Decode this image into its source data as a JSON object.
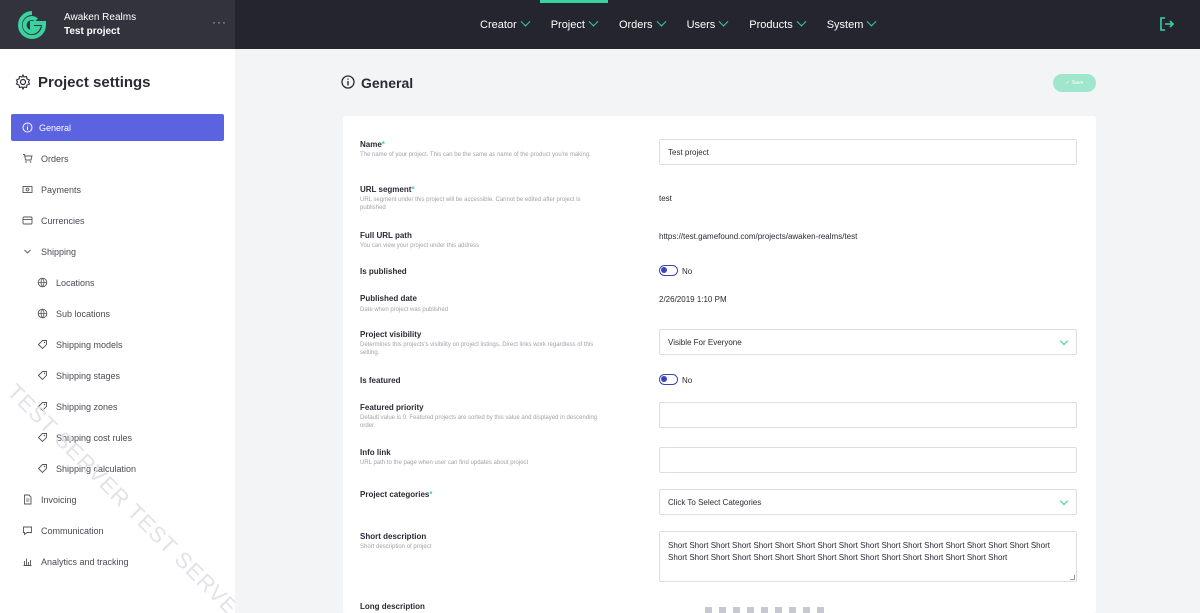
{
  "app": {
    "name": "Awaken Realms",
    "project": "Test project",
    "more": "···"
  },
  "colors": {
    "accent": "#3ad29f",
    "active": "#5b63e0",
    "topbar": "#25252f"
  },
  "nav": {
    "items": [
      {
        "label": "Creator"
      },
      {
        "label": "Project"
      },
      {
        "label": "Orders"
      },
      {
        "label": "Users"
      },
      {
        "label": "Products"
      },
      {
        "label": "System"
      }
    ],
    "active": "Project"
  },
  "sidebar": {
    "title": "Project settings",
    "items": [
      {
        "label": "General",
        "icon": "info-icon"
      },
      {
        "label": "Orders",
        "icon": "cart-icon"
      },
      {
        "label": "Payments",
        "icon": "cash-icon"
      },
      {
        "label": "Currencies",
        "icon": "currency-icon"
      },
      {
        "label": "Shipping",
        "icon": "chevron-down-icon"
      },
      {
        "label": "Locations",
        "icon": "globe-icon"
      },
      {
        "label": "Sub locations",
        "icon": "globe-icon"
      },
      {
        "label": "Shipping models",
        "icon": "tag-icon"
      },
      {
        "label": "Shipping stages",
        "icon": "tag-icon"
      },
      {
        "label": "Shipping zones",
        "icon": "tag-icon"
      },
      {
        "label": "Shipping cost rules",
        "icon": "tag-icon"
      },
      {
        "label": "Shipping calculation",
        "icon": "tag-icon"
      },
      {
        "label": "Invoicing",
        "icon": "document-icon"
      },
      {
        "label": "Communication",
        "icon": "chat-icon"
      },
      {
        "label": "Analytics and tracking",
        "icon": "chart-icon"
      }
    ],
    "watermark": "TEST SERVER TEST SERVER"
  },
  "main": {
    "title": "General",
    "save_label": "Save"
  },
  "form": {
    "name": {
      "label": "Name",
      "help": "The name of your project. This can be the same as name of the product you're making.",
      "value": "Test project"
    },
    "url_segment": {
      "label": "URL segment",
      "help": "URL segment under this project will be accessible. Cannot be edited after project is published",
      "value": "test"
    },
    "full_url": {
      "label": "Full URL path",
      "help": "You can view your project under this address",
      "value": "https://test.gamefound.com/projects/awaken-realms/test"
    },
    "is_published": {
      "label": "Is published",
      "value": "No"
    },
    "published_date": {
      "label": "Published date",
      "help": "Date when project was published",
      "value": "2/26/2019 1:10 PM"
    },
    "visibility": {
      "label": "Project visibility",
      "help": "Determines this projects's visibility on project listings. Direct links work regardless of this setting.",
      "value": "Visible For Everyone"
    },
    "is_featured": {
      "label": "Is featured",
      "value": "No"
    },
    "featured_priority": {
      "label": "Featured priority",
      "help": "Default value is 0. Featured projects are sorted by this value and displayed in descending order.",
      "value": ""
    },
    "info_link": {
      "label": "Info link",
      "help": "URL path to the page when user can find updates about project",
      "value": ""
    },
    "categories": {
      "label": "Project categories",
      "value": "Click To Select Categories"
    },
    "short_description": {
      "label": "Short description",
      "help": "Short description of project",
      "value": "Short Short Short Short Short Short Short Short Short Short Short Short Short Short Short Short Short Short Short Short Short Short Short Short Short Short Short Short Short Short Short Short Short Short"
    },
    "long_description": {
      "label": "Long description"
    },
    "required_mark": "*"
  }
}
